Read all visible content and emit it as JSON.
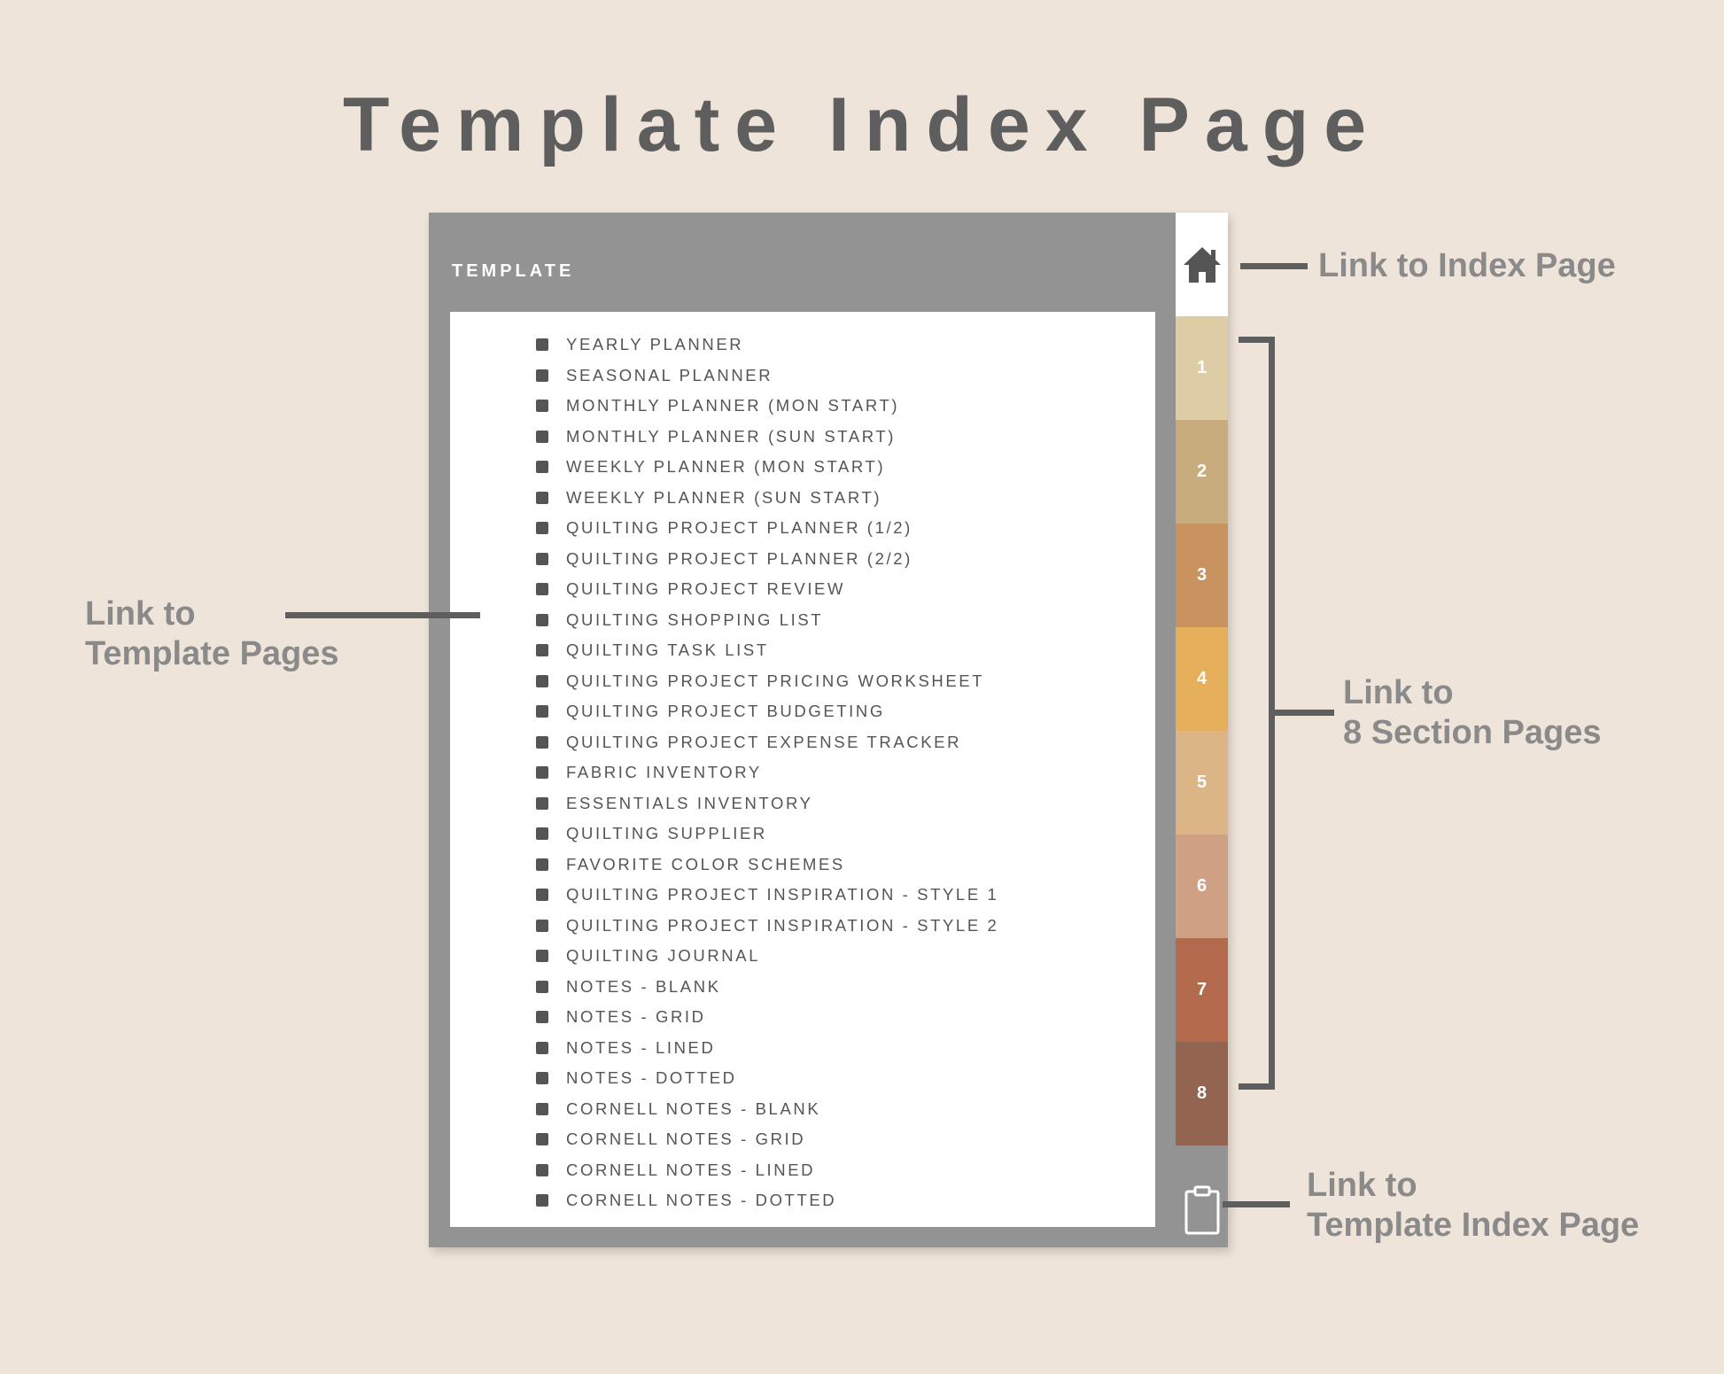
{
  "title": "Template Index Page",
  "header": {
    "label": "TEMPLATE"
  },
  "template_items": [
    "YEARLY PLANNER",
    "SEASONAL PLANNER",
    "MONTHLY PLANNER (MON START)",
    "MONTHLY PLANNER (SUN START)",
    "WEEKLY PLANNER (MON START)",
    "WEEKLY PLANNER (SUN START)",
    "QUILTING PROJECT PLANNER (1/2)",
    "QUILTING PROJECT PLANNER (2/2)",
    "QUILTING PROJECT REVIEW",
    "QUILTING SHOPPING LIST",
    "QUILTING TASK LIST",
    "QUILTING PROJECT PRICING WORKSHEET",
    "QUILTING PROJECT BUDGETING",
    "QUILTING PROJECT EXPENSE TRACKER",
    "FABRIC INVENTORY",
    "ESSENTIALS INVENTORY",
    "QUILTING SUPPLIER",
    "FAVORITE COLOR SCHEMES",
    "QUILTING PROJECT INSPIRATION - STYLE 1",
    "QUILTING PROJECT INSPIRATION - STYLE 2",
    "QUILTING JOURNAL",
    "NOTES - BLANK",
    "NOTES - GRID",
    "NOTES - LINED",
    "NOTES - DOTTED",
    "CORNELL NOTES - BLANK",
    "CORNELL NOTES - GRID",
    "CORNELL NOTES - LINED",
    "CORNELL NOTES - DOTTED"
  ],
  "tabs": {
    "home_icon": "home-icon",
    "clipboard_icon": "clipboard-icon",
    "sections": [
      {
        "label": "1",
        "color": "#ddcca4"
      },
      {
        "label": "2",
        "color": "#c9ac7e"
      },
      {
        "label": "3",
        "color": "#c8935e"
      },
      {
        "label": "4",
        "color": "#e5af5b"
      },
      {
        "label": "5",
        "color": "#dbb585"
      },
      {
        "label": "6",
        "color": "#d0a084"
      },
      {
        "label": "7",
        "color": "#b36a4d"
      },
      {
        "label": "8",
        "color": "#93644f"
      }
    ]
  },
  "callouts": {
    "index": {
      "line1": "Link to Index Page"
    },
    "templates": {
      "line1": "Link to",
      "line2": "Template Pages"
    },
    "sections": {
      "line1": "Link to",
      "line2": "8 Section Pages"
    },
    "template_index": {
      "line1": "Link to",
      "line2": "Template Index Page"
    }
  },
  "colors": {
    "background": "#efe4da",
    "frame": "#939393",
    "text_dark": "#5e5e5e",
    "callout_text": "#8a8a8a"
  }
}
